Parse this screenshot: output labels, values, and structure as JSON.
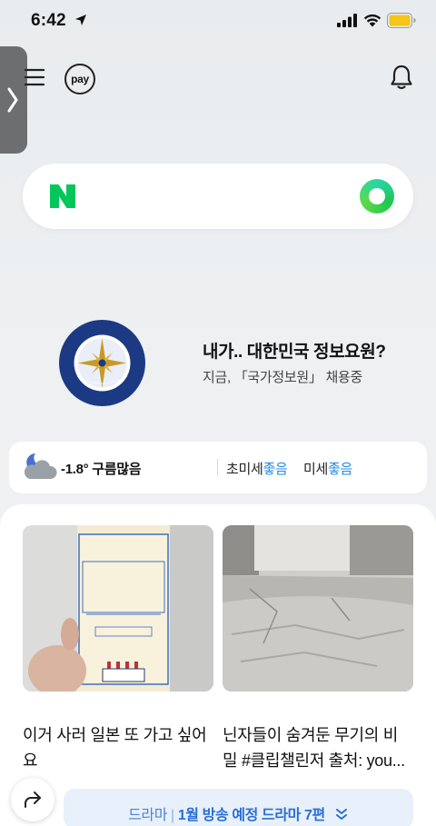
{
  "status_bar": {
    "time": "6:42"
  },
  "header": {
    "pay_label": "pay"
  },
  "ad": {
    "title": "내가.. 대한민국 정보요원?",
    "subtitle": "지금, 「국가정보원」 채용중"
  },
  "weather": {
    "temperature": "-1.8°",
    "condition": "구름많음",
    "fine_dust_label": "초미세",
    "fine_dust_status": "좋음",
    "dust_label": "미세",
    "dust_status": "좋음"
  },
  "feed": [
    {
      "caption": "이거 사러 일본 또 가고 싶어요",
      "image": "royal-milk-tea-bottle"
    },
    {
      "caption_line1": "닌자들이 숨겨둔 무기의 비",
      "caption_line2": "밀 #클립챌린저 출처: you...",
      "image": "stone-floor"
    }
  ],
  "drama_banner": {
    "category": "드라마",
    "title": "1월 방송 예정 드라마 7편"
  },
  "colors": {
    "naver_green": "#03c75a",
    "accent_blue": "#1e88e5"
  }
}
